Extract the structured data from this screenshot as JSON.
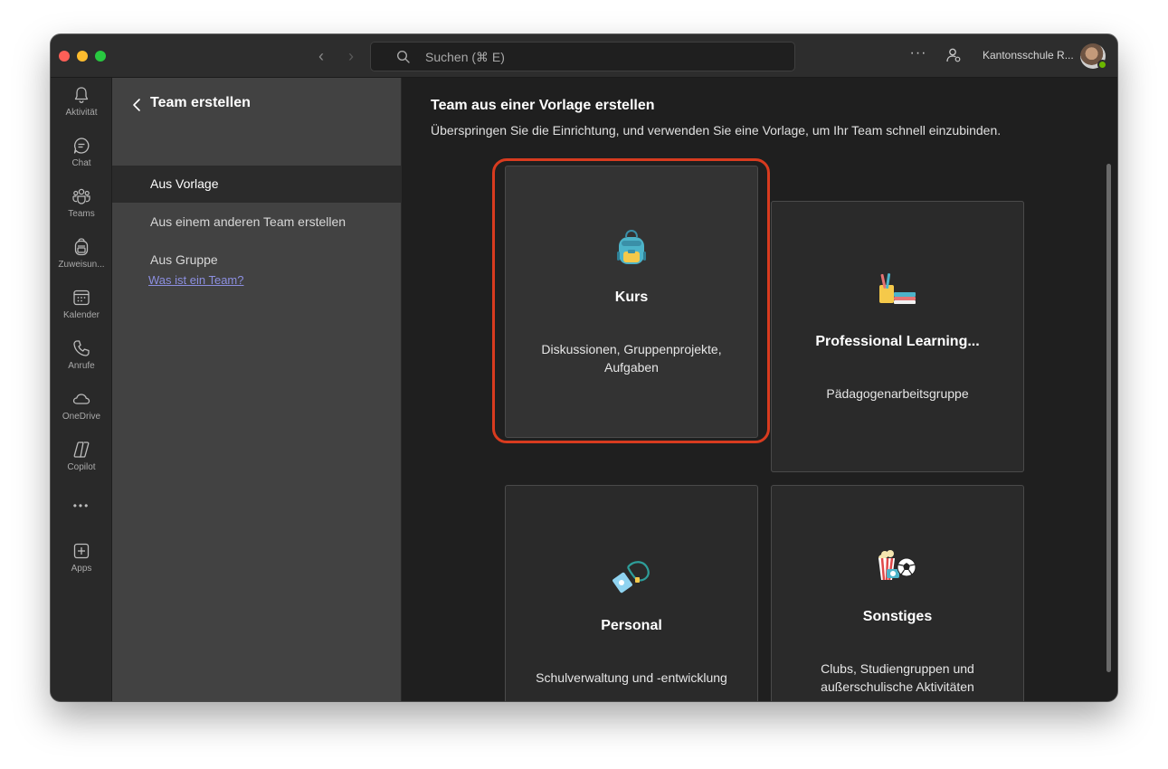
{
  "titlebar": {
    "search_placeholder": "Suchen (⌘ E)",
    "org_name": "Kantonsschule R...",
    "more_label": "···"
  },
  "rail": {
    "items": [
      {
        "label": "Aktivität",
        "icon": "bell-icon"
      },
      {
        "label": "Chat",
        "icon": "chat-icon"
      },
      {
        "label": "Teams",
        "icon": "teams-icon"
      },
      {
        "label": "Zuweisun...",
        "icon": "backpack-icon"
      },
      {
        "label": "Kalender",
        "icon": "calendar-icon"
      },
      {
        "label": "Anrufe",
        "icon": "phone-icon"
      },
      {
        "label": "OneDrive",
        "icon": "cloud-icon"
      },
      {
        "label": "Copilot",
        "icon": "copilot-icon"
      },
      {
        "label": "Apps",
        "icon": "apps-icon"
      }
    ],
    "more_label": "•••"
  },
  "panel": {
    "title": "Team erstellen",
    "items": [
      {
        "label": "Aus Vorlage"
      },
      {
        "label": "Aus einem anderen Team erstellen"
      },
      {
        "label": "Aus Gruppe"
      }
    ],
    "help_link": "Was ist ein Team?"
  },
  "main": {
    "title": "Team aus einer Vorlage erstellen",
    "subtitle": "Überspringen Sie die Einrichtung, und verwenden Sie eine Vorlage, um Ihr Team schnell einzubinden.",
    "cards": [
      {
        "title": "Kurs",
        "desc": "Diskussionen, Gruppenprojekte, Aufgaben",
        "icon": "backpack-icon"
      },
      {
        "title": "Professional Learning...",
        "desc": "Pädagogenarbeitsgruppe",
        "icon": "books-pencils-icon"
      },
      {
        "title": "Personal",
        "desc": "Schulverwaltung und -entwicklung",
        "icon": "lanyard-badge-icon"
      },
      {
        "title": "Sonstiges",
        "desc": "Clubs, Studiengruppen und außerschulische Aktivitäten",
        "icon": "popcorn-soccer-icon"
      }
    ]
  },
  "colors": {
    "highlight": "#d83b1f",
    "accent_link": "#8c8fe0",
    "status_available": "#6bb700"
  }
}
